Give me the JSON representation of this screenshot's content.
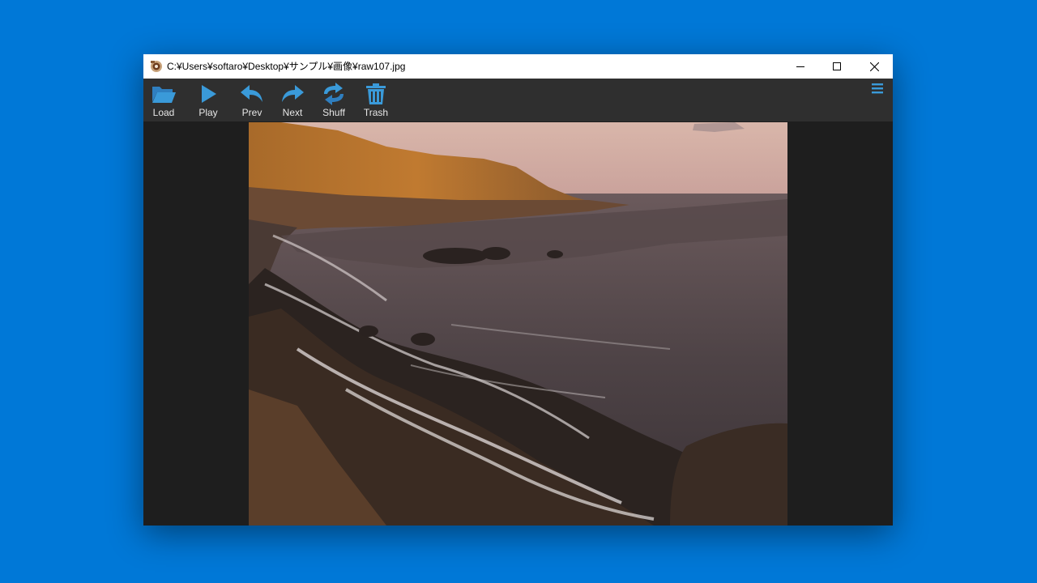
{
  "window": {
    "title": "C:¥Users¥softaro¥Desktop¥サンプル¥画像¥raw107.jpg"
  },
  "toolbar": {
    "buttons": [
      {
        "id": "load",
        "label": "Load",
        "icon": "folder-open-icon"
      },
      {
        "id": "play",
        "label": "Play",
        "icon": "play-icon"
      },
      {
        "id": "prev",
        "label": "Prev",
        "icon": "undo-arrow-icon"
      },
      {
        "id": "next",
        "label": "Next",
        "icon": "redo-arrow-icon"
      },
      {
        "id": "shuff",
        "label": "Shuff",
        "icon": "shuffle-icon"
      },
      {
        "id": "trash",
        "label": "Trash",
        "icon": "trash-icon"
      }
    ],
    "menu_icon": "hamburger-menu-icon"
  },
  "colors": {
    "desktop": "#0078d7",
    "toolbar_bg": "#2f2f2f",
    "viewer_bg": "#1e1e1e",
    "icon_blue": "#3a9ad9"
  },
  "viewer": {
    "image_subject": "rocky coastline at sunset with waves"
  }
}
